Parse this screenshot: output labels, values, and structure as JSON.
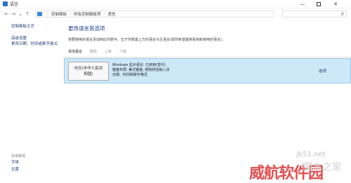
{
  "window": {
    "title": "语言"
  },
  "address": {
    "crumbs": [
      "控制面板",
      "所有控制面板项",
      "语言"
    ]
  },
  "leftnav": {
    "home": "控制面板主页",
    "items": [
      "高级设置",
      "更改日期、时间或数字格式"
    ]
  },
  "seealso": {
    "header": "另请参阅",
    "items": [
      "字体",
      "位置"
    ]
  },
  "main": {
    "heading": "更改语言首选项",
    "description": "将要使用的语言添加到此列表中。位于列表最上方的语言为主语言(即你希望最常看到和使用的语言)。",
    "toolbar": {
      "add": "添加语言",
      "remove": "删除",
      "up": "上移",
      "down": "下移"
    },
    "language": {
      "name_line1": "中文(中华人民共",
      "name_line2": "和国)",
      "details": [
        "Windows 显示语言: 已启用(替代)",
        "键盘布局: 美式键盘, 搜狗拼音输入法",
        "日期、时间和数字格式"
      ],
      "options": "选项"
    }
  },
  "watermark": {
    "site": "jb51.net",
    "text": "威航软件园",
    "text2": "脚本之家"
  }
}
